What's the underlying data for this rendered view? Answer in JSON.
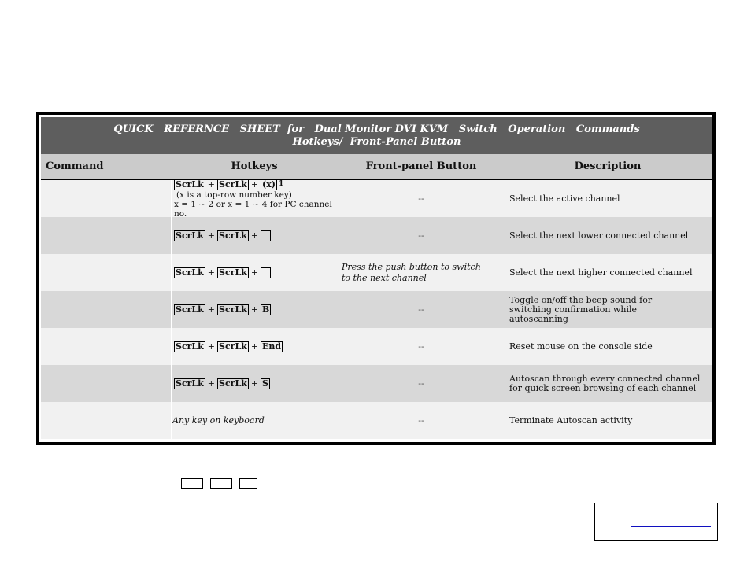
{
  "title": {
    "line1": "QUICK   REFERNCE   SHEET  for   Dual Monitor DVI KVM   Switch   Operation   Commands",
    "line2": "Hotkeys/  Front-Panel Button"
  },
  "columns": {
    "command": "Command",
    "hotkeys": "Hotkeys",
    "front_panel": "Front-panel Button",
    "description": "Description"
  },
  "rows": [
    {
      "command": "",
      "keys": [
        "ScrLk",
        "ScrLk",
        "(x)"
      ],
      "superscript": "1",
      "notes": [
        "(x is a top-row number key)",
        "x = 1 ~ 2 or x = 1 ~ 4 for PC channel no."
      ],
      "front_panel": "--",
      "description": "Select the active channel"
    },
    {
      "command": "",
      "keys": [
        "ScrLk",
        "ScrLk",
        ""
      ],
      "front_panel": "--",
      "description": "Select the next lower connected channel"
    },
    {
      "command": "",
      "keys": [
        "ScrLk",
        "ScrLk",
        ""
      ],
      "front_panel": "Press the push  button to switch to the next channel",
      "description": "Select the next higher connected channel"
    },
    {
      "command": "",
      "keys": [
        "ScrLk",
        "ScrLk",
        "B"
      ],
      "front_panel": "--",
      "description": "Toggle on/off the beep sound for switching confirmation while autoscanning"
    },
    {
      "command": "",
      "keys": [
        "ScrLk",
        "ScrLk",
        "End"
      ],
      "front_panel": "--",
      "description": "Reset mouse on the console side"
    },
    {
      "command": "",
      "keys": [
        "ScrLk",
        "ScrLk",
        "S"
      ],
      "front_panel": "--",
      "description": "Autoscan through every connected channel for quick screen browsing of each channel"
    },
    {
      "command": "",
      "hotkey_text": "Any key on keyboard",
      "front_panel": "--",
      "description": "Terminate Autoscan activity"
    }
  ],
  "plus_sign": "+",
  "colors": {
    "title_bg": "#5e5e5e",
    "header_bg": "#cbcbcb",
    "row_light": "#f1f1f1",
    "row_dark": "#d8d8d8",
    "underline_blue": "#1010c0"
  }
}
